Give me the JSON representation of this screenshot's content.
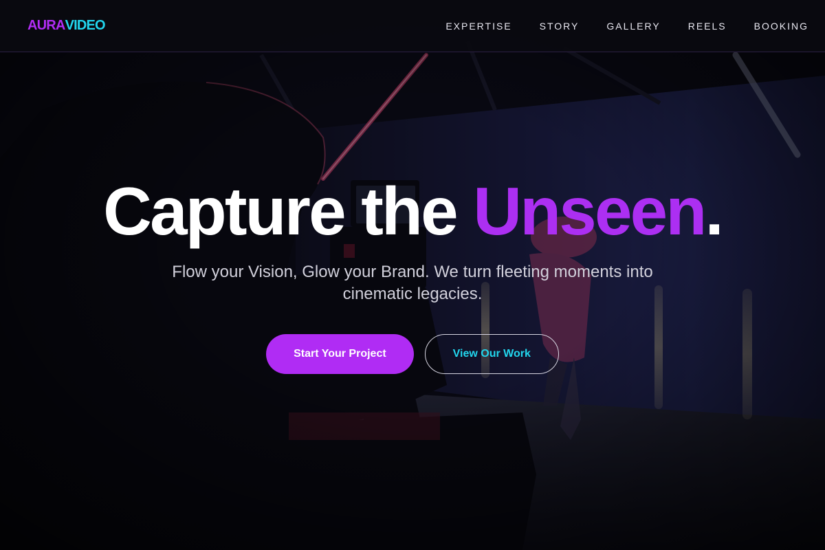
{
  "header": {
    "logo": {
      "part1": "AURA",
      "part2": "VIDEO"
    },
    "nav": [
      {
        "label": "EXPERTISE"
      },
      {
        "label": "STORY"
      },
      {
        "label": "GALLERY"
      },
      {
        "label": "REELS"
      },
      {
        "label": "BOOKING"
      }
    ]
  },
  "hero": {
    "headline": {
      "text": "Capture the ",
      "accent": "Unseen",
      "end": "."
    },
    "subtitle": "Flow your Vision, Glow your Brand. We turn fleeting moments into cinematic legacies.",
    "buttons": {
      "primary": "Start Your Project",
      "secondary": "View Our Work"
    }
  },
  "colors": {
    "brand_purple": "#b02cf4",
    "brand_cyan": "#22d6ee",
    "background": "#0b0a12"
  }
}
